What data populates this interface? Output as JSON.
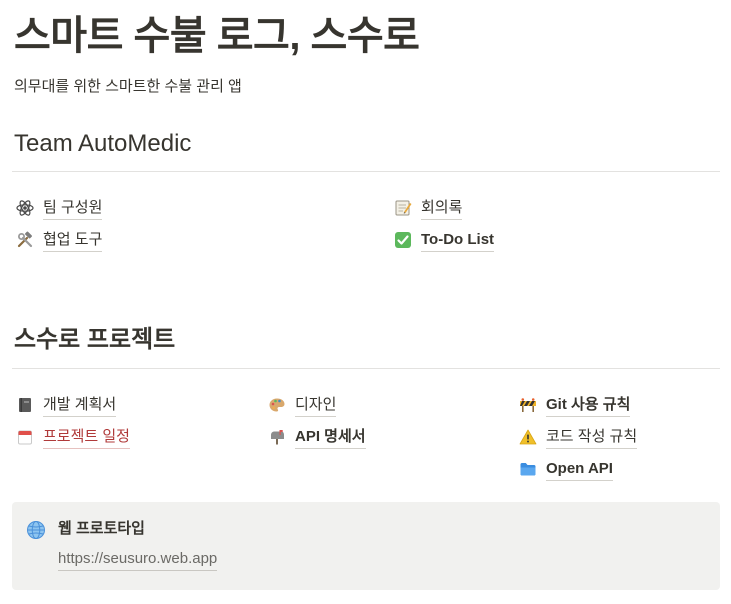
{
  "page": {
    "title": "스마트 수불 로그, 스수로",
    "subtitle": "의무대를 위한 스마트한 수불 관리 앱"
  },
  "team_section": {
    "heading": "Team AutoMedic",
    "links": [
      {
        "label": "팀 구성원",
        "icon": "atom-icon"
      },
      {
        "label": "회의록",
        "icon": "memo-icon"
      },
      {
        "label": "협업 도구",
        "icon": "hammer-wrench-icon"
      },
      {
        "label": "To-Do List",
        "icon": "check-mark-icon"
      }
    ]
  },
  "project_section": {
    "heading": "스수로 프로젝트",
    "links": [
      {
        "label": "개발 계획서",
        "icon": "notebook-icon"
      },
      {
        "label": "디자인",
        "icon": "artist-palette-icon"
      },
      {
        "label": "Git 사용 규칙",
        "icon": "construction-barrier-icon"
      },
      {
        "label": "프로젝트 일정",
        "icon": "calendar-icon"
      },
      {
        "label": "API 명세서",
        "icon": "mailbox-icon"
      },
      {
        "label": "코드 작성 규칙",
        "icon": "warning-icon"
      },
      {
        "label": "Open API",
        "icon": "folder-icon"
      }
    ]
  },
  "callout": {
    "title": "웹 프로토타입",
    "url": "https://seusuro.web.app",
    "icon": "globe-icon"
  },
  "colors": {
    "text": "#37352f",
    "divider": "#e3e2e0",
    "callout_bg": "#f1f1ef",
    "link_red": "#b03a3a"
  }
}
